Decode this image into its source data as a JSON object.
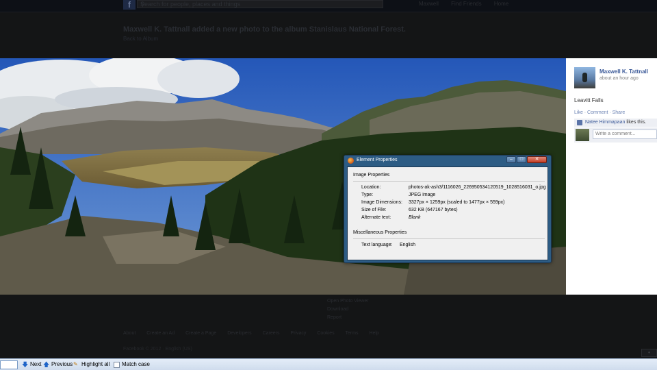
{
  "facebook": {
    "search_placeholder": "Search for people, places and things",
    "top_icons": [
      "Maxwell",
      "Find Friends",
      "Home"
    ],
    "headline": "Maxwell K. Tattnall added a new photo to the album Stanislaus National Forest.",
    "back_link": "Back to Album",
    "author": "Maxwell K. Tattnall",
    "time": "about an hour ago",
    "caption": "Leavitt Falls",
    "actions": "Like · Comment · Share",
    "liker": "Natee Himmapaan",
    "likes_text": " likes this.",
    "comment_placeholder": "Write a comment...",
    "photo_links": [
      "Open Photo Viewer",
      "Download",
      "Report"
    ],
    "footer_links": [
      "About",
      "Create an Ad",
      "Create a Page",
      "Developers",
      "Careers",
      "Privacy",
      "Cookies",
      "Terms",
      "Help"
    ],
    "copyright": "Facebook © 2012 · English (US)"
  },
  "dialog": {
    "title": "Element Properties",
    "image_section": "Image Properties",
    "location_label": "Location:",
    "location_value": "photos-ak-ash3/1116026_226950534120519_1028516031_o.jpg",
    "type_label": "Type:",
    "type_value": "JPEG image",
    "dimensions_label": "Image Dimensions:",
    "dimensions_value": "3327px × 1259px (scaled to 1477px × 559px)",
    "size_label": "Size of File:",
    "size_value": "632 KB (647167 bytes)",
    "alt_label": "Alternate text:",
    "alt_value": "Blank",
    "misc_section": "Miscellaneous Properties",
    "lang_label": "Text language:",
    "lang_value": "English"
  },
  "findbar": {
    "next": "Next",
    "previous": "Previous",
    "highlight_all": "Highlight all",
    "match_case": "Match case"
  }
}
